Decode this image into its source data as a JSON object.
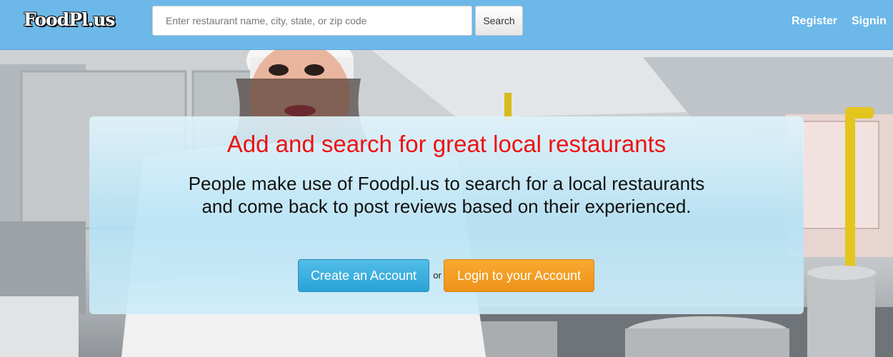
{
  "brand": {
    "logo_text": "FoodPl.us"
  },
  "search": {
    "placeholder": "Enter restaurant name, city, state, or zip code",
    "value": "",
    "button_label": "Search"
  },
  "nav": {
    "register_label": "Register",
    "signin_label": "Signin"
  },
  "hero": {
    "headline": "Add and search for great local restaurants",
    "description": "People make use of Foodpl.us to search for a local restaurants and come back to post reviews based on their experienced.",
    "create_account_label": "Create an Account",
    "or_text": "or",
    "login_label": "Login to your Account"
  },
  "colors": {
    "navbar": "#6cb8e9",
    "headline": "#ee1111",
    "create_button": "#2aa3d6",
    "login_button": "#ee9218"
  }
}
